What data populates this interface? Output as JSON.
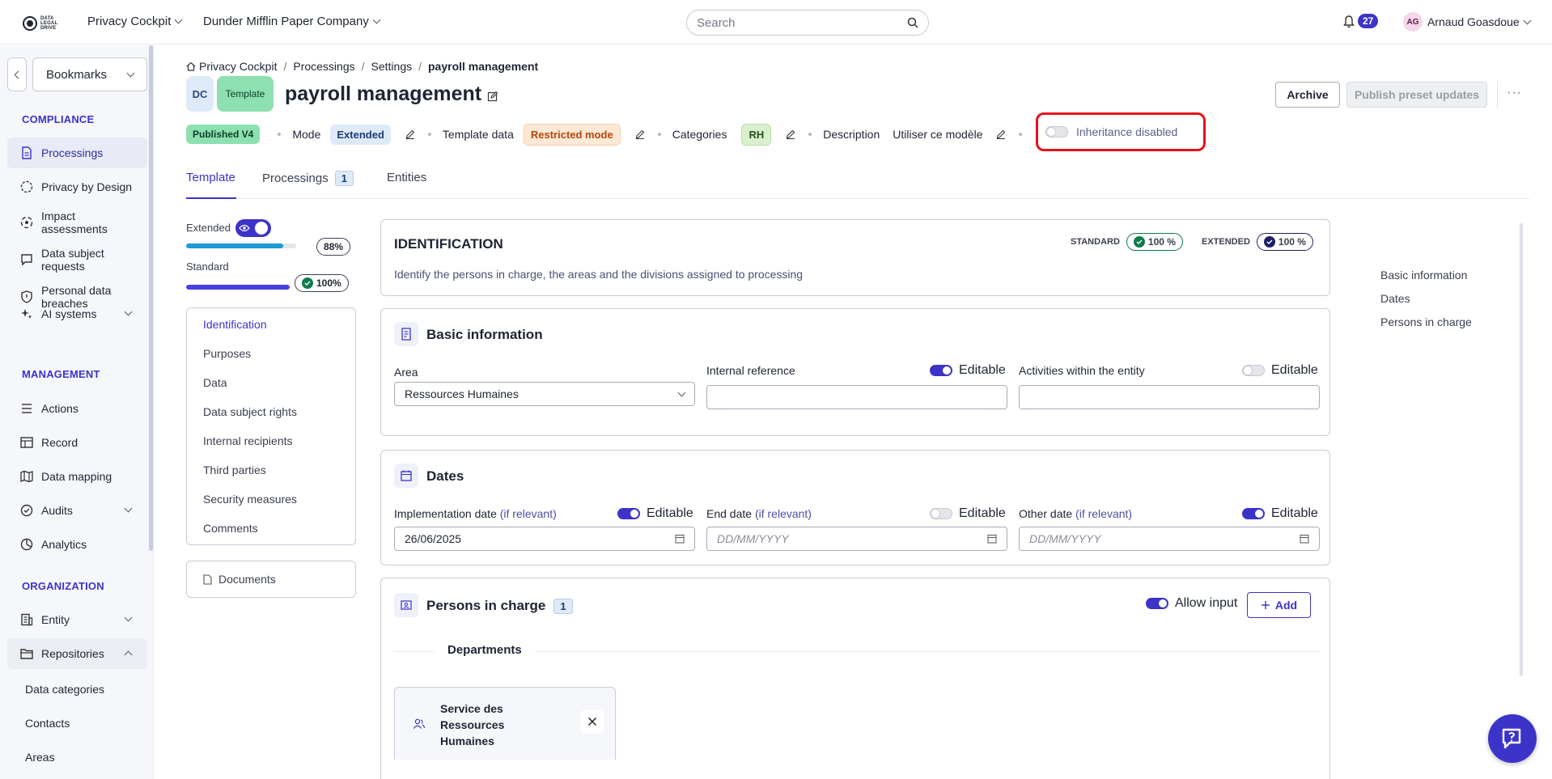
{
  "topbar": {
    "logo_text": "DATA LEGAL DRIVE",
    "app_switcher": "Privacy Cockpit",
    "company_switcher": "Dunder Mifflin Paper Company",
    "search_placeholder": "Search",
    "notifications_count": "27",
    "user_initials": "AG",
    "user_name": "Arnaud Goasdoue"
  },
  "sidebar": {
    "bookmarks_label": "Bookmarks",
    "sections": [
      {
        "title": "COMPLIANCE",
        "items": [
          {
            "label": "Processings",
            "icon": "document-icon",
            "active": true
          },
          {
            "label": "Privacy by Design",
            "icon": "dashed-circle-icon"
          },
          {
            "label": "Impact assessments",
            "icon": "target-icon"
          },
          {
            "label": "Data subject requests",
            "icon": "chat-icon"
          },
          {
            "label": "Personal data breaches",
            "icon": "shield-icon"
          },
          {
            "label": "AI systems",
            "icon": "sparkles-icon",
            "expandable": true
          }
        ]
      },
      {
        "title": "MANAGEMENT",
        "items": [
          {
            "label": "Actions",
            "icon": "list-icon"
          },
          {
            "label": "Record",
            "icon": "table-icon"
          },
          {
            "label": "Data mapping",
            "icon": "map-icon"
          },
          {
            "label": "Audits",
            "icon": "check-circle-icon",
            "expandable": true
          },
          {
            "label": "Analytics",
            "icon": "pie-chart-icon"
          }
        ]
      },
      {
        "title": "ORGANIZATION",
        "items": [
          {
            "label": "Entity",
            "icon": "building-icon",
            "expandable": true
          },
          {
            "label": "Repositories",
            "icon": "folder-icon",
            "expanded": true
          }
        ]
      }
    ],
    "sub_items": [
      "Data categories",
      "Contacts",
      "Areas"
    ]
  },
  "breadcrumb": [
    "Privacy Cockpit",
    "Processings",
    "Settings",
    "payroll management"
  ],
  "header": {
    "tag_dc": "DC",
    "tag_template": "Template",
    "title": "payroll management",
    "archive_label": "Archive",
    "publish_label": "Publish preset updates"
  },
  "meta": {
    "status": "Published V4",
    "mode_label": "Mode",
    "mode_value": "Extended",
    "template_data_label": "Template data",
    "template_data_value": "Restricted mode",
    "categories_label": "Categories",
    "categories_value": "RH",
    "description_label": "Description",
    "description_value": "Utiliser ce modèle",
    "inheritance_label": "Inheritance disabled"
  },
  "tabs": [
    {
      "label": "Template",
      "active": true
    },
    {
      "label": "Processings",
      "count": "1"
    },
    {
      "label": "Entities"
    }
  ],
  "progress": {
    "extended_label": "Extended",
    "extended_pct_label": "88%",
    "extended_fraction": 0.88,
    "standard_label": "Standard",
    "standard_pct_label": "100%",
    "standard_fraction": 1.0
  },
  "section_nav": [
    "Identification",
    "Purposes",
    "Data",
    "Data subject rights",
    "Internal recipients",
    "Third parties",
    "Security measures",
    "Comments"
  ],
  "documents_label": "Documents",
  "identification": {
    "title": "IDENTIFICATION",
    "description": "Identify the persons in charge, the areas and the divisions assigned to processing",
    "standard_label": "STANDARD",
    "standard_pct": "100 %",
    "extended_label": "EXTENDED",
    "extended_pct": "100 %"
  },
  "basic_info": {
    "title": "Basic information",
    "area_label": "Area",
    "area_value": "Ressources Humaines",
    "internal_ref_label": "Internal reference",
    "activities_label": "Activities within the entity",
    "editable_label": "Editable"
  },
  "dates": {
    "title": "Dates",
    "impl_label": "Implementation date",
    "end_label": "End date",
    "other_label": "Other date",
    "relevant_hint": "(if relevant)",
    "impl_value": "26/06/2025",
    "date_placeholder": "DD/MM/YYYY",
    "editable_label": "Editable"
  },
  "persons": {
    "title": "Persons in charge",
    "count": "1",
    "allow_input_label": "Allow input",
    "add_label": "Add",
    "departments_label": "Departments",
    "department_name": "Service des Ressources Humaines"
  },
  "toc": [
    "Basic information",
    "Dates",
    "Persons in charge"
  ],
  "colors": {
    "accent": "#3c33c8",
    "highlight_border": "#e3141c"
  }
}
